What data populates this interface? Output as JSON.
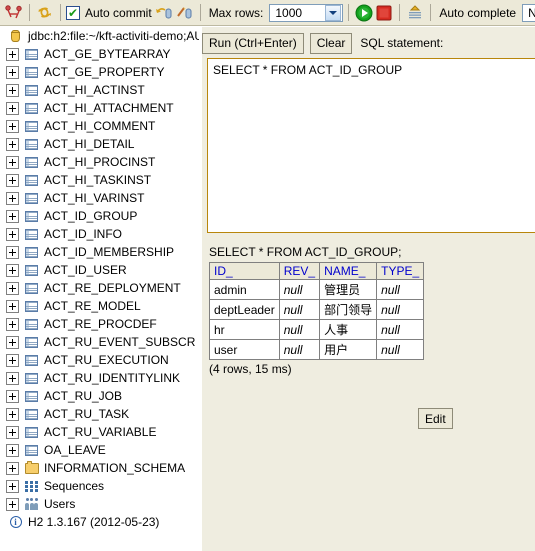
{
  "toolbar": {
    "icons": [
      {
        "name": "disconnect-icon"
      },
      {
        "name": "refresh-icon"
      }
    ],
    "auto_commit_label": "Auto commit",
    "auto_commit_checked": true,
    "commit_icon": "commit-icon",
    "rollback_icon": "rollback-icon",
    "max_rows_label": "Max rows:",
    "max_rows_value": "1000",
    "run_icon": "run-icon",
    "stop_icon": "stop-icon",
    "clear_output_icon": "clear-output-icon",
    "auto_complete_label": "Auto complete",
    "auto_complete_value": "No",
    "accent_green": "#11A11D",
    "accent_red": "#D62B21",
    "toolbar_bg": "#ECE9D8"
  },
  "tree": {
    "root": {
      "label": "jdbc:h2:file:~/kft-activiti-demo;AU",
      "icon": "database-icon"
    },
    "tables": [
      "ACT_GE_BYTEARRAY",
      "ACT_GE_PROPERTY",
      "ACT_HI_ACTINST",
      "ACT_HI_ATTACHMENT",
      "ACT_HI_COMMENT",
      "ACT_HI_DETAIL",
      "ACT_HI_PROCINST",
      "ACT_HI_TASKINST",
      "ACT_HI_VARINST",
      "ACT_ID_GROUP",
      "ACT_ID_INFO",
      "ACT_ID_MEMBERSHIP",
      "ACT_ID_USER",
      "ACT_RE_DEPLOYMENT",
      "ACT_RE_MODEL",
      "ACT_RE_PROCDEF",
      "ACT_RU_EVENT_SUBSCR",
      "ACT_RU_EXECUTION",
      "ACT_RU_IDENTITYLINK",
      "ACT_RU_JOB",
      "ACT_RU_TASK",
      "ACT_RU_VARIABLE",
      "OA_LEAVE"
    ],
    "schema": {
      "label": "INFORMATION_SCHEMA",
      "icon": "folder-icon"
    },
    "sequences": {
      "label": "Sequences",
      "icon": "sequences-icon"
    },
    "users": {
      "label": "Users",
      "icon": "users-icon"
    },
    "version": {
      "label": "H2 1.3.167 (2012-05-23)",
      "icon": "info-icon"
    }
  },
  "commands": {
    "run_label": "Run (Ctrl+Enter)",
    "clear_label": "Clear",
    "sql_statement_label": "SQL statement:"
  },
  "editor": {
    "sql": "SELECT * FROM ACT_ID_GROUP"
  },
  "results": {
    "executed_sql": "SELECT * FROM ACT_ID_GROUP;",
    "columns": [
      "ID_",
      "REV_",
      "NAME_",
      "TYPE_"
    ],
    "rows": [
      [
        "admin",
        "null",
        "管理员",
        "null"
      ],
      [
        "deptLeader",
        "null",
        "部门领导",
        "null"
      ],
      [
        "hr",
        "null",
        "人事",
        "null"
      ],
      [
        "user",
        "null",
        "用户",
        "null"
      ]
    ],
    "row_info": "(4 rows, 15 ms)",
    "edit_label": "Edit",
    "header_color": "#0000CD"
  }
}
